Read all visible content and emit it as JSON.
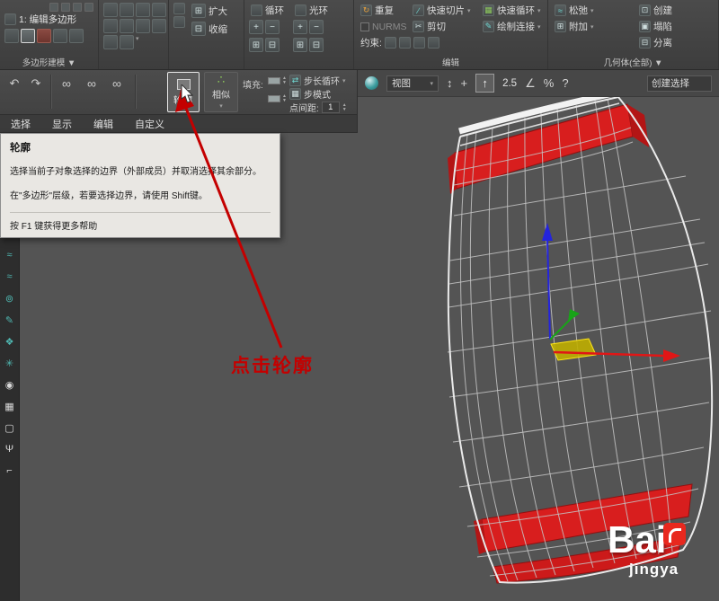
{
  "ribbon": {
    "modifier_label": "1: 编辑多边形",
    "panel1_footer": "多边形建模 ▼",
    "grow": "扩大",
    "shrink": "收缩",
    "loop": "循环",
    "ring": "光环",
    "repeat": "重复",
    "nurms": "NURMS",
    "constraints": "约束:",
    "quickslice": "快速切片",
    "cut": "剪切",
    "swiftloop": "快速循环",
    "paintconnect": "绘制连接",
    "relax": "松弛",
    "attach": "附加",
    "create": "创建",
    "collapse": "塌陷",
    "detach": "分离",
    "edit_footer": "编辑",
    "geometry_footer": "几何体(全部) ▼"
  },
  "icons": {
    "undo": "↶",
    "redo": "↷",
    "link": "∞",
    "grow": "⊞",
    "shrink": "⊟",
    "plus": "+",
    "minus": "−",
    "repeat": "↻",
    "quickslice": "∕",
    "swiftloop": "▦",
    "cut": "✂",
    "paintconnect": "✎",
    "relax": "≈",
    "attach": "⊞",
    "create": "⊡",
    "collapse": "▣",
    "detach": "⊟",
    "caret": "▾",
    "step_loop": "⇄",
    "step_mode": "▦",
    "similar": "∴",
    "move": "+",
    "pan": "↕",
    "up_arrow": "↑",
    "angle": "∠",
    "percent": "%",
    "help": "?"
  },
  "toolbar": {
    "border_label": "轮廓",
    "similar_label": "相似",
    "fill_label": "填充:",
    "step_loop_label": "步长循环",
    "step_mode_label": "步模式",
    "point_spacing_label": "点间距:",
    "point_spacing_value": "1"
  },
  "tabs": [
    "选择",
    "显示",
    "编辑",
    "自定义"
  ],
  "tooltip": {
    "title": "轮廓",
    "body1": "选择当前子对象选择的边界（外部成员）并取消选择其余部分。",
    "body2": "在\"多边形\"层级，若要选择边界，请使用 Shift键。",
    "footer": "按 F1 键获得更多帮助"
  },
  "annotation": {
    "label": "点击轮廓"
  },
  "vtoolbar": {
    "view_label": "视图",
    "snap_label": "2.5",
    "selection_label": "创建选择"
  },
  "left_strip": {
    "icons": [
      "≈",
      "≈",
      "≈",
      "⊚",
      "✎",
      "❖",
      "✳",
      "◉",
      "▦",
      "▢",
      "Ψ",
      "⌐"
    ]
  },
  "watermark": {
    "line1": "Bai",
    "line2": "jingya"
  }
}
